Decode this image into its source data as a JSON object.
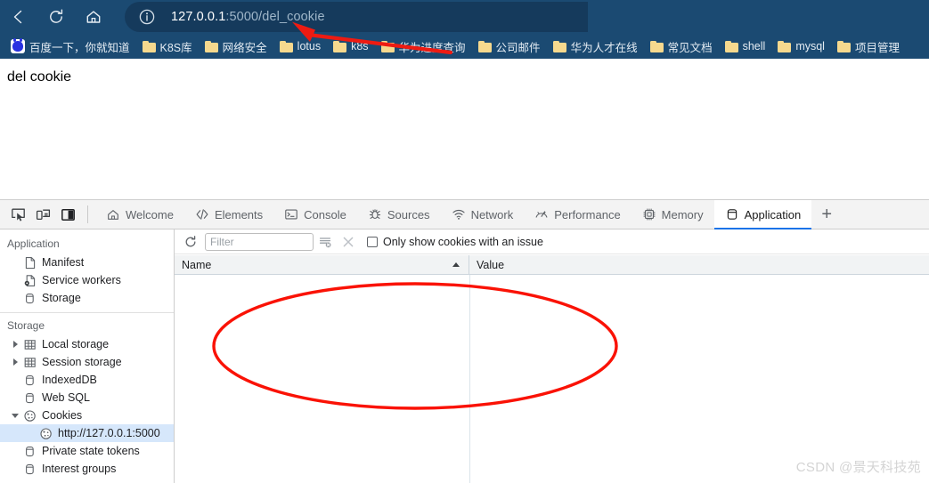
{
  "browser": {
    "nav": [
      {
        "name": "back-button",
        "icon": "back-arrow-icon",
        "label": "Back"
      },
      {
        "name": "reload-button",
        "icon": "reload-icon",
        "label": "Reload"
      },
      {
        "name": "home-button",
        "icon": "home-icon",
        "label": "Home"
      }
    ],
    "address_bar": {
      "info_icon": "info-circle-icon",
      "host": "127.0.0.1",
      "rest": ":5000/del_cookie",
      "full_url": "127.0.0.1:5000/del_cookie"
    },
    "bookmarks": [
      {
        "icon": "baidu-favicon",
        "label": "百度一下，你就知道"
      },
      {
        "icon": "folder-icon",
        "label": "K8S库"
      },
      {
        "icon": "folder-icon",
        "label": "网络安全"
      },
      {
        "icon": "folder-icon",
        "label": "lotus"
      },
      {
        "icon": "folder-icon",
        "label": "k8s"
      },
      {
        "icon": "folder-icon",
        "label": "华为进度查询"
      },
      {
        "icon": "folder-icon",
        "label": "公司邮件"
      },
      {
        "icon": "folder-icon",
        "label": "华为人才在线"
      },
      {
        "icon": "folder-icon",
        "label": "常见文档"
      },
      {
        "icon": "folder-icon",
        "label": "shell"
      },
      {
        "icon": "folder-icon",
        "label": "mysql"
      },
      {
        "icon": "folder-icon",
        "label": "项目管理"
      }
    ]
  },
  "page": {
    "body_text": "del cookie"
  },
  "devtools": {
    "tool_buttons": [
      {
        "name": "inspect-element-button",
        "icon": "inspect-cursor-icon"
      },
      {
        "name": "device-toolbar-button",
        "icon": "device-toggle-icon"
      },
      {
        "name": "dock-panel-button",
        "icon": "dock-side-icon"
      }
    ],
    "tabs": [
      {
        "label": "Welcome",
        "icon": "home-icon",
        "active": false
      },
      {
        "label": "Elements",
        "icon": "code-brackets-icon",
        "active": false
      },
      {
        "label": "Console",
        "icon": "console-prompt-icon",
        "active": false
      },
      {
        "label": "Sources",
        "icon": "bug-icon",
        "active": false
      },
      {
        "label": "Network",
        "icon": "wifi-icon",
        "active": false
      },
      {
        "label": "Performance",
        "icon": "speedometer-icon",
        "active": false
      },
      {
        "label": "Memory",
        "icon": "chip-icon",
        "active": false
      },
      {
        "label": "Application",
        "icon": "database-icon",
        "active": true
      }
    ],
    "add_tab_label": "+",
    "sidebar": {
      "sections": [
        {
          "title": "Application",
          "items": [
            {
              "label": "Manifest",
              "icon": "document-icon",
              "indent": 1,
              "twisty": "none",
              "selected": false
            },
            {
              "label": "Service workers",
              "icon": "service-worker-icon",
              "indent": 1,
              "twisty": "none",
              "selected": false
            },
            {
              "label": "Storage",
              "icon": "database-icon",
              "indent": 1,
              "twisty": "none",
              "selected": false
            }
          ]
        },
        {
          "title": "Storage",
          "items": [
            {
              "label": "Local storage",
              "icon": "table-grid-icon",
              "indent": 1,
              "twisty": "closed",
              "selected": false
            },
            {
              "label": "Session storage",
              "icon": "table-grid-icon",
              "indent": 1,
              "twisty": "closed",
              "selected": false
            },
            {
              "label": "IndexedDB",
              "icon": "database-icon",
              "indent": 1,
              "twisty": "none",
              "selected": false
            },
            {
              "label": "Web SQL",
              "icon": "database-icon",
              "indent": 1,
              "twisty": "none",
              "selected": false
            },
            {
              "label": "Cookies",
              "icon": "cookie-icon",
              "indent": 1,
              "twisty": "open",
              "selected": false
            },
            {
              "label": "http://127.0.0.1:5000",
              "icon": "cookie-icon",
              "indent": 2,
              "twisty": "none",
              "selected": true
            },
            {
              "label": "Private state tokens",
              "icon": "database-icon",
              "indent": 1,
              "twisty": "none",
              "selected": false
            },
            {
              "label": "Interest groups",
              "icon": "database-icon",
              "indent": 1,
              "twisty": "none",
              "selected": false
            }
          ]
        }
      ]
    },
    "cookies_panel": {
      "refresh_icon": "refresh-icon",
      "filter_placeholder": "Filter",
      "filter_value": "",
      "clear_filtered_icon": "clear-filtered-icon",
      "clear_all_icon": "clear-all-x-icon",
      "only_issues_label": "Only show cookies with an issue",
      "only_issues_checked": false,
      "columns": [
        {
          "label": "Name",
          "sorted": true,
          "sort_dir": "asc"
        },
        {
          "label": "Value",
          "sorted": false,
          "sort_dir": ""
        }
      ],
      "rows": []
    }
  },
  "annotations": {
    "arrow": {
      "name": "red-arrow-annotation",
      "color": "#ee1b12"
    },
    "ellipse": {
      "name": "red-ellipse-annotation",
      "color": "#fa1205"
    }
  },
  "watermark": {
    "text": "CSDN @景天科技苑",
    "color": "#d4d4d4"
  },
  "colors": {
    "chrome_bg": "#1b4a72",
    "url_pill_bg": "#153a5c",
    "devtools_toolbar_bg": "#f3f3f3",
    "active_tab_underline": "#1a73e8",
    "selection_bg": "#d6e7fb",
    "annotation_red": "#fa1205"
  }
}
